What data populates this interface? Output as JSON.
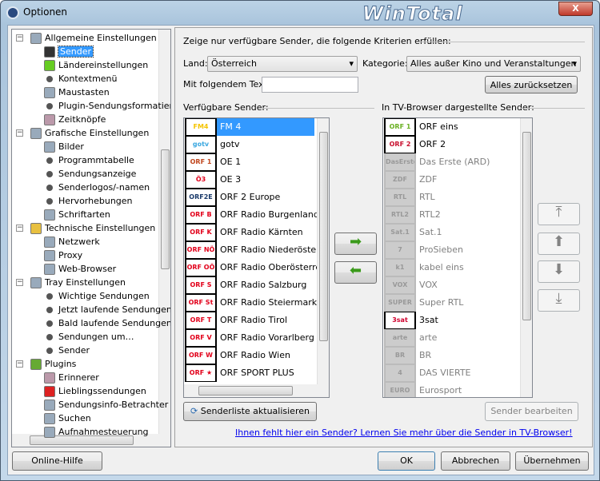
{
  "window": {
    "title": "Optionen",
    "brand_logo": "WinTotal",
    "close_label": "X"
  },
  "tree": {
    "items": [
      {
        "label": "Allgemeine Einstellungen",
        "level": 0,
        "icon": "tools-icon"
      },
      {
        "label": "Sender",
        "level": 1,
        "icon": "remote-icon",
        "selected": true
      },
      {
        "label": "Ländereinstellungen",
        "level": 1,
        "icon": "flag-icon"
      },
      {
        "label": "Kontextmenü",
        "level": 1,
        "icon": "bullet"
      },
      {
        "label": "Maustasten",
        "level": 1,
        "icon": "mouse-icon"
      },
      {
        "label": "Plugin-Sendungsformatierung",
        "level": 1,
        "icon": "bullet"
      },
      {
        "label": "Zeitknöpfe",
        "level": 1,
        "icon": "clock-icon"
      },
      {
        "label": "Grafische Einstellungen",
        "level": 0,
        "icon": "monitor-icon"
      },
      {
        "label": "Bilder",
        "level": 1,
        "icon": "picture-icon"
      },
      {
        "label": "Programmtabelle",
        "level": 1,
        "icon": "bullet"
      },
      {
        "label": "Sendungsanzeige",
        "level": 1,
        "icon": "bullet"
      },
      {
        "label": "Senderlogos/-namen",
        "level": 1,
        "icon": "bullet"
      },
      {
        "label": "Hervorhebungen",
        "level": 1,
        "icon": "bullet"
      },
      {
        "label": "Schriftarten",
        "level": 1,
        "icon": "font-icon"
      },
      {
        "label": "Technische Einstellungen",
        "level": 0,
        "icon": "folder-icon"
      },
      {
        "label": "Netzwerk",
        "level": 1,
        "icon": "network-icon"
      },
      {
        "label": "Proxy",
        "level": 1,
        "icon": "proxy-icon"
      },
      {
        "label": "Web-Browser",
        "level": 1,
        "icon": "globe-icon"
      },
      {
        "label": "Tray Einstellungen",
        "level": 0,
        "icon": "tools-icon"
      },
      {
        "label": "Wichtige Sendungen",
        "level": 1,
        "icon": "bullet"
      },
      {
        "label": "Jetzt laufende Sendungen",
        "level": 1,
        "icon": "bullet"
      },
      {
        "label": "Bald laufende Sendungen",
        "level": 1,
        "icon": "bullet"
      },
      {
        "label": "Sendungen um…",
        "level": 1,
        "icon": "bullet"
      },
      {
        "label": "Sender",
        "level": 1,
        "icon": "bullet"
      },
      {
        "label": "Plugins",
        "level": 0,
        "icon": "puzzle-icon"
      },
      {
        "label": "Erinnerer",
        "level": 1,
        "icon": "clock-icon"
      },
      {
        "label": "Lieblingssendungen",
        "level": 1,
        "icon": "heart-icon"
      },
      {
        "label": "Sendungsinfo-Betrachter",
        "level": 1,
        "icon": "magnifier-icon"
      },
      {
        "label": "Suchen",
        "level": 1,
        "icon": "search-icon"
      },
      {
        "label": "Aufnahmesteuerung",
        "level": 1,
        "icon": "record-icon"
      }
    ]
  },
  "filter": {
    "heading": "Zeige nur verfügbare Sender, die folgende Kriterien erfüllen:",
    "land_label": "Land:",
    "land_value": "Österreich",
    "kategorie_label": "Kategorie:",
    "kategorie_value": "Alles außer Kino und Veranstaltungen",
    "text_label": "Mit folgendem Text:",
    "text_value": "",
    "text_placeholder": "",
    "reset_label": "Alles zurücksetzen"
  },
  "available": {
    "heading": "Verfügbare Sender:",
    "items": [
      {
        "name": "FM 4",
        "logo": "FM4",
        "color": "#f5c400",
        "selected": true
      },
      {
        "name": "gotv",
        "logo": "gotv",
        "color": "#3aa7e0"
      },
      {
        "name": "OE 1",
        "logo": "ORF 1",
        "color": "#c0461d"
      },
      {
        "name": "OE 3",
        "logo": "Ö3",
        "color": "#e2001a"
      },
      {
        "name": "ORF 2 Europe",
        "logo": "ORF2E",
        "color": "#1a3a6a"
      },
      {
        "name": "ORF Radio Burgenland",
        "logo": "ORF B",
        "color": "#e2001a"
      },
      {
        "name": "ORF Radio Kärnten",
        "logo": "ORF K",
        "color": "#e2001a"
      },
      {
        "name": "ORF Radio Niederösterreich",
        "logo": "ORF NÖ",
        "color": "#e2001a"
      },
      {
        "name": "ORF Radio Oberösterreich",
        "logo": "ORF OÖ",
        "color": "#e2001a"
      },
      {
        "name": "ORF Radio Salzburg",
        "logo": "ORF S",
        "color": "#e2001a"
      },
      {
        "name": "ORF Radio Steiermark",
        "logo": "ORF St",
        "color": "#e2001a"
      },
      {
        "name": "ORF Radio Tirol",
        "logo": "ORF T",
        "color": "#e2001a"
      },
      {
        "name": "ORF Radio Vorarlberg",
        "logo": "ORF V",
        "color": "#e2001a"
      },
      {
        "name": "ORF Radio Wien",
        "logo": "ORF W",
        "color": "#e2001a"
      },
      {
        "name": "ORF SPORT PLUS",
        "logo": "ORF ★",
        "color": "#e2001a"
      }
    ],
    "refresh_label": "Senderliste aktualisieren"
  },
  "shown": {
    "heading": "In TV-Browser dargestellte Sender:",
    "items": [
      {
        "name": "ORF eins",
        "logo": "ORF 1",
        "color": "#6ab023",
        "available": true
      },
      {
        "name": "ORF 2",
        "logo": "ORF 2",
        "color": "#c8102e",
        "available": true
      },
      {
        "name": "Das Erste (ARD)",
        "logo": "DasErste",
        "available": false
      },
      {
        "name": "ZDF",
        "logo": "ZDF",
        "available": false
      },
      {
        "name": "RTL",
        "logo": "RTL",
        "available": false
      },
      {
        "name": "RTL2",
        "logo": "RTL2",
        "available": false
      },
      {
        "name": "Sat.1",
        "logo": "Sat.1",
        "available": false
      },
      {
        "name": "ProSieben",
        "logo": "7",
        "available": false
      },
      {
        "name": "kabel eins",
        "logo": "k1",
        "available": false
      },
      {
        "name": "VOX",
        "logo": "VOX",
        "available": false
      },
      {
        "name": "Super RTL",
        "logo": "SUPER",
        "available": false
      },
      {
        "name": "3sat",
        "logo": "3sat",
        "color": "#d0002d",
        "available": true
      },
      {
        "name": "arte",
        "logo": "arte",
        "available": false
      },
      {
        "name": "BR",
        "logo": "BR",
        "available": false
      },
      {
        "name": "DAS VIERTE",
        "logo": "4",
        "available": false
      },
      {
        "name": "Eurosport",
        "logo": "EURO",
        "available": false
      }
    ],
    "edit_label": "Sender bearbeiten"
  },
  "help_link": "Ihnen fehlt hier ein Sender? Lernen Sie mehr über die Sender in TV-Browser!",
  "footer": {
    "help": "Online-Hilfe",
    "ok": "OK",
    "cancel": "Abbrechen",
    "apply": "Übernehmen"
  }
}
